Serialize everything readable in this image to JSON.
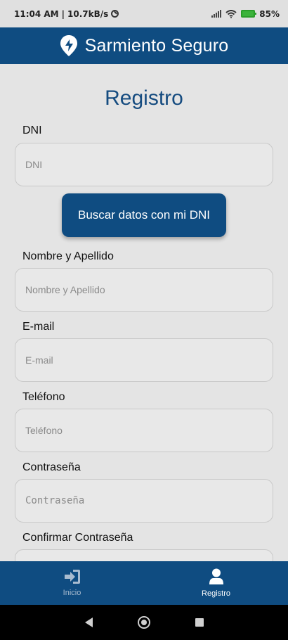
{
  "status_bar": {
    "time": "11:04 AM",
    "network_speed": "10.7kB/s",
    "battery_percent": "85%",
    "battery_color": "#3bb33b"
  },
  "app_bar": {
    "title": "Sarmiento Seguro",
    "logo_icon": "location-pin-logo-icon",
    "color": "#0f4c81"
  },
  "form": {
    "title": "Registro",
    "dni": {
      "label": "DNI",
      "placeholder": "DNI",
      "value": ""
    },
    "search_button": "Buscar datos con mi DNI",
    "name": {
      "label": "Nombre y Apellido",
      "placeholder": "Nombre y Apellido",
      "value": ""
    },
    "email": {
      "label": "E-mail",
      "placeholder": "E-mail",
      "value": ""
    },
    "phone": {
      "label": "Teléfono",
      "placeholder": "Teléfono",
      "value": ""
    },
    "password": {
      "label": "Contraseña",
      "placeholder": "Contraseña",
      "value": ""
    },
    "confirm_password": {
      "label": "Confirmar Contraseña",
      "placeholder": "",
      "value": ""
    }
  },
  "bottom_nav": {
    "items": [
      {
        "label": "Inicio",
        "icon": "sign-in-icon",
        "active": false
      },
      {
        "label": "Registro",
        "icon": "user-icon",
        "active": true
      }
    ]
  },
  "system_nav": {
    "buttons": [
      "back",
      "home",
      "recents"
    ]
  }
}
